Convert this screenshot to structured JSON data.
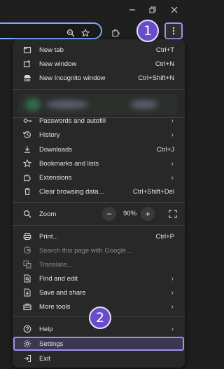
{
  "window": {
    "minimize_icon": "minimize-icon",
    "restore_icon": "restore-icon",
    "close_icon": "close-icon"
  },
  "toolbar": {
    "omnibox_icons": [
      "zoom-icon",
      "star-icon"
    ],
    "extensions_icon": "puzzle-icon",
    "menu_icon": "kebab-icon"
  },
  "annotations": {
    "step1": "1",
    "step2": "2",
    "accent": "#a58cf0"
  },
  "menu": {
    "group1": [
      {
        "label": "New tab",
        "shortcut": "Ctrl+T",
        "icon": "new-tab-icon"
      },
      {
        "label": "New window",
        "shortcut": "Ctrl+N",
        "icon": "new-window-icon"
      },
      {
        "label": "New Incognito window",
        "shortcut": "Ctrl+Shift+N",
        "icon": "incognito-icon"
      }
    ],
    "group2": [
      {
        "label": "Passwords and autofill",
        "icon": "key-icon",
        "submenu": true
      },
      {
        "label": "History",
        "icon": "history-icon",
        "submenu": true
      },
      {
        "label": "Downloads",
        "shortcut": "Ctrl+J",
        "icon": "download-icon"
      },
      {
        "label": "Bookmarks and lists",
        "icon": "star-icon",
        "submenu": true
      },
      {
        "label": "Extensions",
        "icon": "puzzle-icon",
        "submenu": true
      },
      {
        "label": "Clear browsing data...",
        "shortcut": "Ctrl+Shift+Del",
        "icon": "trash-icon"
      }
    ],
    "zoom": {
      "label": "Zoom",
      "value": "90%",
      "minus": "−",
      "plus": "+",
      "icon": "magnifier-icon"
    },
    "group3": [
      {
        "label": "Print...",
        "shortcut": "Ctrl+P",
        "icon": "print-icon"
      },
      {
        "label": "Search this page with Google...",
        "icon": "google-icon",
        "disabled": true
      },
      {
        "label": "Translate...",
        "icon": "translate-icon",
        "disabled": true
      },
      {
        "label": "Find and edit",
        "icon": "find-icon",
        "submenu": true
      },
      {
        "label": "Save and share",
        "icon": "save-icon",
        "submenu": true
      },
      {
        "label": "More tools",
        "icon": "toolbox-icon",
        "submenu": true
      }
    ],
    "group4": [
      {
        "label": "Help",
        "icon": "help-icon",
        "submenu": true
      },
      {
        "label": "Settings",
        "icon": "gear-icon"
      },
      {
        "label": "Exit",
        "icon": "exit-icon"
      }
    ]
  }
}
